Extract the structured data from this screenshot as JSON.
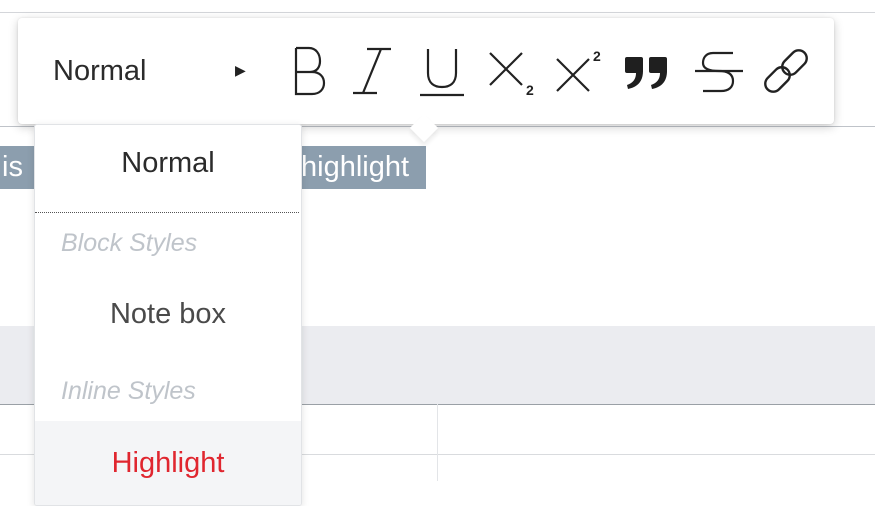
{
  "editor": {
    "selected_text_left": "is",
    "selected_text_right": "highlight"
  },
  "toolbar": {
    "style_select_label": "Normal",
    "buttons": [
      {
        "name": "bold",
        "icon": "bold-icon"
      },
      {
        "name": "italic",
        "icon": "italic-icon"
      },
      {
        "name": "underline",
        "icon": "underline-icon"
      },
      {
        "name": "subscript",
        "icon": "subscript-icon"
      },
      {
        "name": "superscript",
        "icon": "superscript-icon"
      },
      {
        "name": "blockquote",
        "icon": "quote-icon"
      },
      {
        "name": "strikethrough",
        "icon": "strikethrough-icon"
      },
      {
        "name": "link",
        "icon": "link-icon"
      }
    ]
  },
  "dropdown": {
    "normal": "Normal",
    "block_heading": "Block Styles",
    "note_box": "Note box",
    "inline_heading": "Inline Styles",
    "highlight": "Highlight"
  },
  "colors": {
    "selection": "#8c9eae",
    "highlight_text": "#e0262f",
    "heading_text": "#bfc4ca"
  }
}
